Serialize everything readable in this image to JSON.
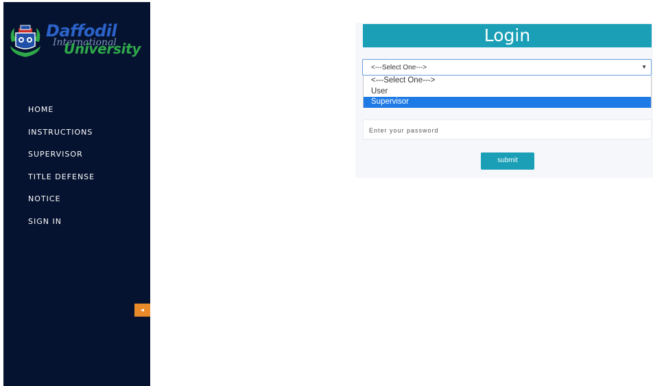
{
  "brand": {
    "line1": "Daffodil",
    "line2": "International",
    "line3": "University"
  },
  "nav": {
    "items": [
      {
        "label": "HOME"
      },
      {
        "label": "INSTRUCTIONS"
      },
      {
        "label": "SUPERVISOR"
      },
      {
        "label": "TITLE DEFENSE"
      },
      {
        "label": "NOTICE"
      },
      {
        "label": "SIGN IN"
      }
    ],
    "collapse_icon": "chevron-left-icon",
    "collapse_glyph": "◂"
  },
  "login": {
    "title": "Login",
    "role_select": {
      "selected": "<---Select One--->",
      "arrow": "▼",
      "options": [
        "<---Select One--->",
        "User",
        "Supervisor"
      ],
      "highlighted": "Supervisor"
    },
    "password_placeholder": "Enter your password",
    "submit_label": "submit"
  },
  "colors": {
    "sidebar": "#061330",
    "accent": "#1a9fb7",
    "collapse": "#e98b2a",
    "highlight": "#1e7be6"
  }
}
